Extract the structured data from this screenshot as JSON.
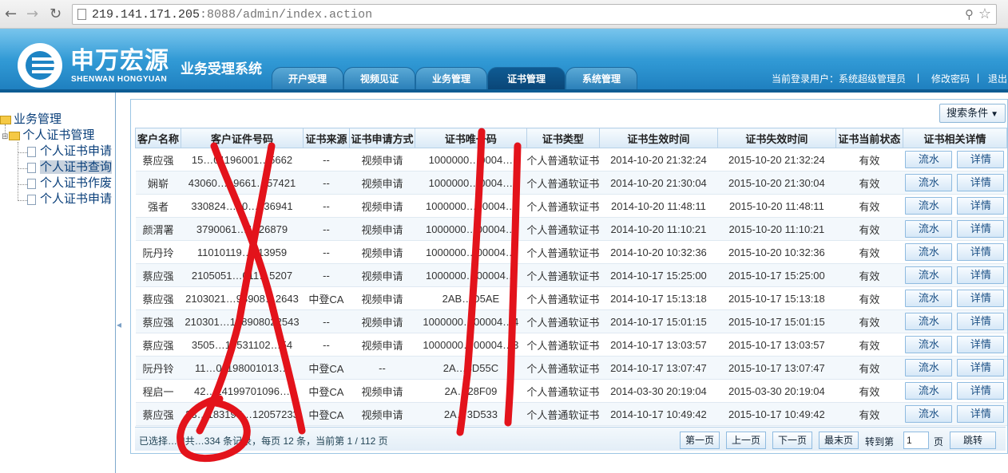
{
  "browser": {
    "url_host": "219.141.171.205",
    "url_path": ":8088/admin/index.action"
  },
  "brand": {
    "name_cn": "申万宏源",
    "name_en": "SHENWAN HONGYUAN",
    "system": "业务受理系统"
  },
  "tabs": [
    {
      "label": "开户受理"
    },
    {
      "label": "视频见证"
    },
    {
      "label": "业务管理"
    },
    {
      "label": "证书管理",
      "active": true
    },
    {
      "label": "系统管理"
    }
  ],
  "user_bar": {
    "current_user": "当前登录用户：系统超级管理员",
    "sep": "|",
    "change_password": "修改密码",
    "logout": "退出"
  },
  "tree": {
    "root": "业务管理",
    "group": "个人证书管理",
    "items": [
      "个人证书申请",
      "个人证书查询",
      "个人证书作废",
      "个人证书申请"
    ],
    "selected_index": 1
  },
  "toolbar": {
    "search_conditions": "搜索条件"
  },
  "table": {
    "columns": [
      "客户名称",
      "客户证件号码",
      "证书来源",
      "证书申请方式",
      "证书唯一码",
      "证书类型",
      "证书生效时间",
      "证书失效时间",
      "证书当前状态",
      "证书相关详情"
    ],
    "actions": {
      "flow": "流水",
      "detail": "详情"
    },
    "rows": [
      [
        "蔡应强",
        "15…01196001…5662",
        "--",
        "视频申请",
        "1000000…0004…",
        "个人普通软证书",
        "2014-10-20 21:32:24",
        "2015-10-20 21:32:24",
        "有效"
      ],
      [
        "娴崭",
        "43060…19661…57421",
        "--",
        "视频申请",
        "1000000…0004…",
        "个人普通软证书",
        "2014-10-20 21:30:04",
        "2015-10-20 21:30:04",
        "有效"
      ],
      [
        "强者",
        "330824…30…136941",
        "--",
        "视频申请",
        "1000000…00004…",
        "个人普通软证书",
        "2014-10-20 11:48:11",
        "2015-10-20 11:48:11",
        "有效"
      ],
      [
        "颜渭署",
        "3790061…1026879",
        "--",
        "视频申请",
        "1000000…00004…",
        "个人普通软证书",
        "2014-10-20 11:10:21",
        "2015-10-20 11:10:21",
        "有效"
      ],
      [
        "阮丹玲",
        "11010119…013959",
        "--",
        "视频申请",
        "1000000…00004…",
        "个人普通软证书",
        "2014-10-20 10:32:36",
        "2015-10-20 10:32:36",
        "有效"
      ],
      [
        "蔡应强",
        "2105051…011…5207",
        "--",
        "视频申请",
        "1000000…00004…",
        "个人普通软证书",
        "2014-10-17 15:25:00",
        "2015-10-17 15:25:00",
        "有效"
      ],
      [
        "蔡应强",
        "2103021…98908…2643",
        "中登CA",
        "视频申请",
        "2AB…D5AE",
        "个人普通软证书",
        "2014-10-17 15:13:18",
        "2015-10-17 15:13:18",
        "有效"
      ],
      [
        "蔡应强",
        "210301…198908022543",
        "--",
        "视频申请",
        "1000000…00004…4",
        "个人普通软证书",
        "2014-10-17 15:01:15",
        "2015-10-17 15:01:15",
        "有效"
      ],
      [
        "蔡应强",
        "3505…19531102…54",
        "--",
        "视频申请",
        "1000000…00004…3",
        "个人普通软证书",
        "2014-10-17 13:03:57",
        "2015-10-17 13:03:57",
        "有效"
      ],
      [
        "阮丹铃",
        "11…01198001013…",
        "中登CA",
        "--",
        "2A…3D55C",
        "个人普通软证书",
        "2014-10-17 13:07:47",
        "2015-10-17 13:07:47",
        "有效"
      ],
      [
        "程启一",
        "42…24199701096…",
        "中登CA",
        "视频申请",
        "2A…28F09",
        "个人普通软证书",
        "2014-03-30 20:19:04",
        "2015-03-30 20:19:04",
        "有效"
      ],
      [
        "蔡应强",
        "33…183197…12057233",
        "中登CA",
        "视频申请",
        "2A…3D533",
        "个人普通软证书",
        "2014-10-17 10:49:42",
        "2015-10-17 10:49:42",
        "有效"
      ]
    ]
  },
  "pager": {
    "summary": "已选择…0|共…334 条记录，每页 12 条，当前第 1 / 112 页",
    "first": "第一页",
    "prev": "上一页",
    "next": "下一页",
    "last": "最末页",
    "goto_label": "转到第",
    "page_value": "1",
    "page_suffix": "页",
    "go": "跳转"
  },
  "colors": {
    "banner": "#2f97d3",
    "tab_active": "#0a4678",
    "marker": "#e3131b"
  }
}
